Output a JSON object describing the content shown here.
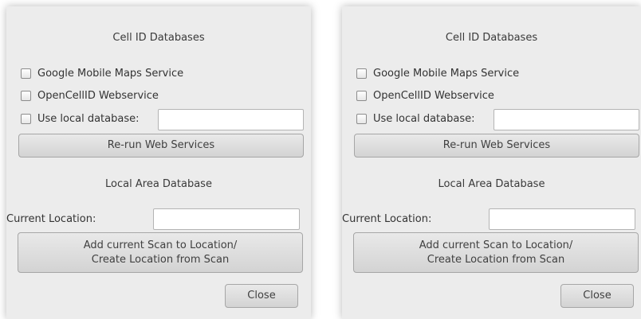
{
  "dialogs": [
    {
      "cell_id_heading": "Cell ID Databases",
      "google_label": "Google Mobile Maps Service",
      "opencellid_label": "OpenCellID Webservice",
      "local_db_label": "Use local database:",
      "local_db_value": "",
      "rerun_label": "Re-run Web Services",
      "local_area_heading": "Local Area Database",
      "current_location_label": "Current Location:",
      "current_location_value": "",
      "add_scan_line1": "Add current Scan to Location/",
      "add_scan_line2": "Create Location from Scan",
      "close_label": "Close"
    },
    {
      "cell_id_heading": "Cell ID Databases",
      "google_label": "Google Mobile Maps Service",
      "opencellid_label": "OpenCellID Webservice",
      "local_db_label": "Use local database:",
      "local_db_value": "",
      "rerun_label": "Re-run Web Services",
      "local_area_heading": "Local Area Database",
      "current_location_label": "Current Location:",
      "current_location_value": "",
      "add_scan_line1": "Add current Scan to Location/",
      "add_scan_line2": "Create Location from Scan",
      "close_label": "Close"
    }
  ]
}
